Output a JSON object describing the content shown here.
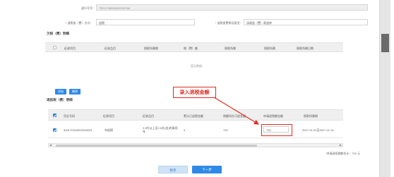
{
  "form": {
    "apply_no_label": "退行号号：",
    "apply_no_value": "TSO1708050300234768",
    "refund_method_label": "退税类（费）方式：",
    "refund_method_value": "退税",
    "refund_reason_label": "退税类费原因类型：",
    "refund_reason_value": "误收退（费）款退库"
  },
  "section_first": {
    "title": "欠税（费）明细",
    "headers": [
      "征收项目",
      "征收品目",
      "税款所属期",
      "税（费）额",
      "税款所属",
      "税款所属",
      "税款所属日期"
    ],
    "empty_text": "暂无数据"
  },
  "toolbar": {
    "add_label": "添加",
    "delete_label": "删除"
  },
  "section_second": {
    "title": "退抵税（费）明细",
    "headers": [
      "凭证号码",
      "征收项目",
      "征收品目",
      "累计已退税金额",
      "税额所在可退金额",
      "申请退税额金额",
      "税款所属期"
    ],
    "row": {
      "voucher_no": "320170316902310823",
      "item": "车船税",
      "sub_item": "2.0升以上至2.5升(含)的乘用车",
      "refunded": "0",
      "refundable": "720",
      "apply_amount": "720",
      "period": "2017-01-01至2017-12-31"
    }
  },
  "annotation": {
    "text": "录入退税金额"
  },
  "summary": {
    "total_text": "申请退抵税额合计：720 元"
  },
  "buttons": {
    "save_label": "暂存",
    "next_label": "下一步"
  },
  "colors": {
    "primary": "#2e8ae6",
    "annotation_red": "#e02b20"
  }
}
